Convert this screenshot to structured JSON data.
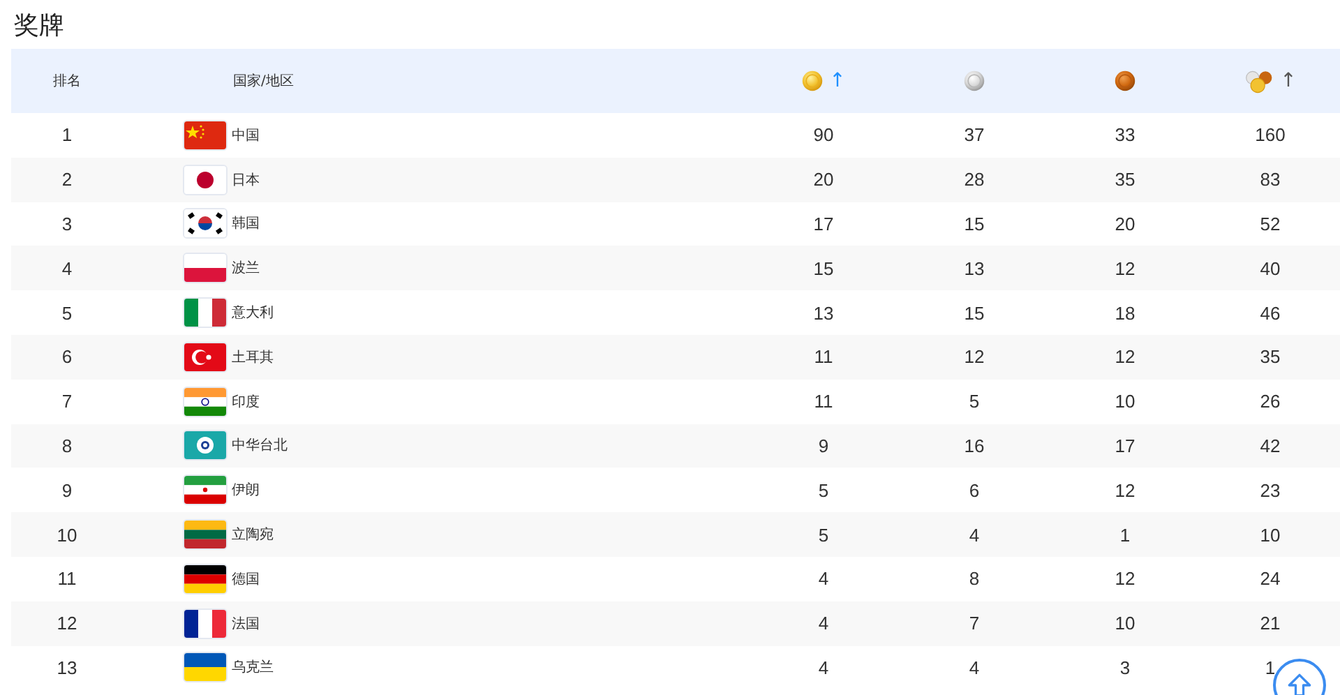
{
  "title": "奖牌",
  "columns": [
    {
      "kind": "text",
      "label": "排名"
    },
    {
      "kind": "text",
      "label": "国家/地区"
    },
    {
      "kind": "gold",
      "arrow": "↑",
      "selected": true
    },
    {
      "kind": "silver"
    },
    {
      "kind": "bronze"
    },
    {
      "kind": "total",
      "arrow": "↑",
      "selected": false
    }
  ],
  "rows": [
    {
      "rank": "1",
      "name": "中国",
      "gold": "90",
      "silver": "37",
      "bronze": "33",
      "total": "160"
    },
    {
      "rank": "2",
      "name": "日本",
      "gold": "20",
      "silver": "28",
      "bronze": "35",
      "total": "83"
    },
    {
      "rank": "3",
      "name": "韩国",
      "gold": "17",
      "silver": "15",
      "bronze": "20",
      "total": "52"
    },
    {
      "rank": "4",
      "name": "波兰",
      "gold": "15",
      "silver": "13",
      "bronze": "12",
      "total": "40"
    },
    {
      "rank": "5",
      "name": "意大利",
      "gold": "13",
      "silver": "15",
      "bronze": "18",
      "total": "46"
    },
    {
      "rank": "6",
      "name": "土耳其",
      "gold": "11",
      "silver": "12",
      "bronze": "12",
      "total": "35"
    },
    {
      "rank": "7",
      "name": "印度",
      "gold": "11",
      "silver": "5",
      "bronze": "10",
      "total": "26"
    },
    {
      "rank": "8",
      "name": "中华台北",
      "gold": "9",
      "silver": "16",
      "bronze": "17",
      "total": "42"
    },
    {
      "rank": "9",
      "name": "伊朗",
      "gold": "5",
      "silver": "6",
      "bronze": "12",
      "total": "23"
    },
    {
      "rank": "10",
      "name": "立陶宛",
      "gold": "5",
      "silver": "4",
      "bronze": "1",
      "total": "10"
    },
    {
      "rank": "11",
      "name": "德国",
      "gold": "4",
      "silver": "8",
      "bronze": "12",
      "total": "24"
    },
    {
      "rank": "12",
      "name": "法国",
      "gold": "4",
      "silver": "7",
      "bronze": "10",
      "total": "21"
    },
    {
      "rank": "13",
      "name": "乌克兰",
      "gold": "4",
      "silver": "4",
      "bronze": "3",
      "total": "1"
    }
  ]
}
